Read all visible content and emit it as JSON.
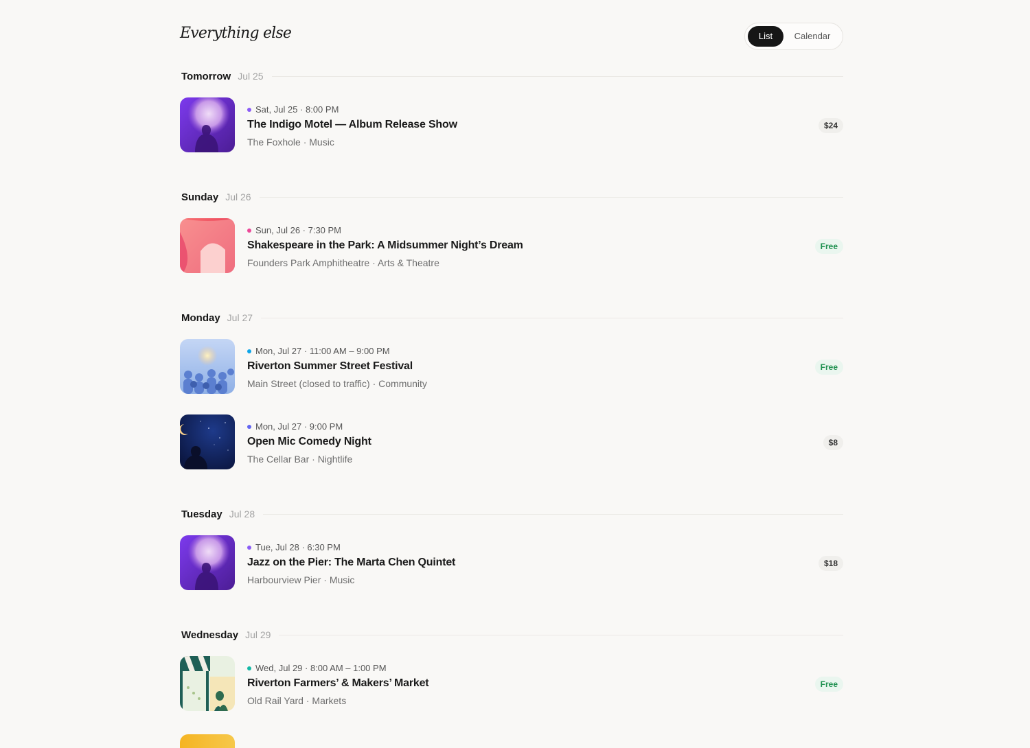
{
  "header": {
    "title": "Everything else",
    "view_toggle": {
      "list": "List",
      "calendar": "Calendar",
      "selected": "List"
    }
  },
  "days": [
    {
      "day": "Tomorrow",
      "date": "Jul 25",
      "events": [
        {
          "when": "Sat, Jul 25 · 8:00 PM",
          "title": "The Indigo Motel — Album Release Show",
          "venue": "The Foxhole · Music",
          "price": "$24",
          "dot_color": "#8b5cf6",
          "thumb": "music"
        }
      ]
    },
    {
      "day": "Sunday",
      "date": "Jul 26",
      "events": [
        {
          "when": "Sun, Jul 26 · 7:30 PM",
          "title": "Shakespeare in the Park: A Midsummer Night’s Dream",
          "venue": "Founders Park Amphitheatre · Arts & Theatre",
          "price": "Free",
          "dot_color": "#ec4899",
          "thumb": "theatre"
        }
      ]
    },
    {
      "day": "Monday",
      "date": "Jul 27",
      "events": [
        {
          "when": "Mon, Jul 27 · 11:00 AM – 9:00 PM",
          "title": "Riverton Summer Street Festival",
          "venue": "Main Street (closed to traffic) · Community",
          "price": "Free",
          "dot_color": "#0ea5e9",
          "thumb": "festival"
        },
        {
          "when": "Mon, Jul 27 · 9:00 PM",
          "title": "Open Mic Comedy Night",
          "venue": "The Cellar Bar · Nightlife",
          "price": "$8",
          "dot_color": "#6366f1",
          "thumb": "comedy"
        }
      ]
    },
    {
      "day": "Tuesday",
      "date": "Jul 28",
      "events": [
        {
          "when": "Tue, Jul 28 · 6:30 PM",
          "title": "Jazz on the Pier: The Marta Chen Quintet",
          "venue": "Harbourview Pier · Music",
          "price": "$18",
          "dot_color": "#8b5cf6",
          "thumb": "music"
        }
      ]
    },
    {
      "day": "Wednesday",
      "date": "Jul 29",
      "events": [
        {
          "when": "Wed, Jul 29 · 8:00 AM – 1:00 PM",
          "title": "Riverton Farmers’ & Makers’ Market",
          "venue": "Old Rail Yard · Markets",
          "price": "Free",
          "dot_color": "#14b8a6",
          "thumb": "market"
        }
      ]
    }
  ]
}
